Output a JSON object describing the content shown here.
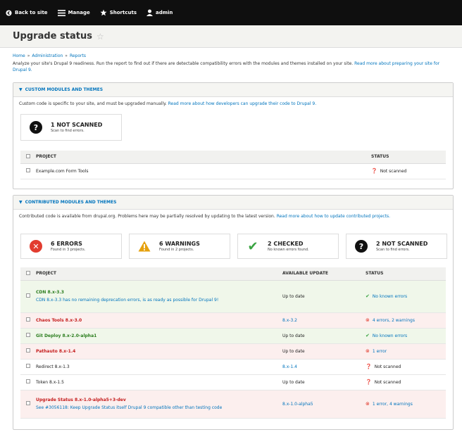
{
  "toolbar": {
    "items": [
      {
        "label": "Back to site",
        "icon": "back-circle-icon"
      },
      {
        "label": "Manage",
        "icon": "menu-icon"
      },
      {
        "label": "Shortcuts",
        "icon": "star-icon"
      },
      {
        "label": "admin",
        "icon": "user-icon"
      }
    ]
  },
  "page": {
    "title": "Upgrade status",
    "title_icon": "star-outline-icon"
  },
  "breadcrumb": [
    "Home",
    "Administration",
    "Reports"
  ],
  "intro": {
    "text": "Analyze your site's Drupal 9 readiness. Run the report to find out if there are detectable compatibility errors with the modules and themes installed on your site.",
    "link": "Read more about preparing your site for Drupal 9."
  },
  "custom": {
    "heading": "CUSTOM MODULES AND THEMES",
    "desc": "Custom code is specific to your site, and must be upgraded manually.",
    "desc_link": "Read more about how developers can upgrade their code to Drupal 9.",
    "summary": {
      "title": "1 NOT SCANNED",
      "sub": "Scan to find errors."
    },
    "columns": [
      "PROJECT",
      "STATUS"
    ],
    "rows": [
      {
        "name": "Example.com Form Tools",
        "status": "Not scanned"
      }
    ]
  },
  "contrib": {
    "heading": "CONTRIBUTED MODULES AND THEMES",
    "desc": "Contributed code is available from drupal.org. Problems here may be partially resolved by updating to the latest version.",
    "desc_link": "Read more about how to update contributed projects.",
    "summaries": [
      {
        "title": "6 ERRORS",
        "sub": "Found in 3 projects.",
        "icon": "error-x-icon",
        "color": "#e23c2f"
      },
      {
        "title": "6 WARNINGS",
        "sub": "Found in 2 projects.",
        "icon": "warning-icon",
        "color": "#e6a10d"
      },
      {
        "title": "2 CHECKED",
        "sub": "No known errors found.",
        "icon": "check-icon",
        "color": "#3aa442"
      },
      {
        "title": "2 NOT SCANNED",
        "sub": "Scan to find errors.",
        "icon": "question-icon",
        "color": "#111111"
      }
    ],
    "columns": [
      "PROJECT",
      "AVAILABLE UPDATE",
      "STATUS"
    ],
    "rows": [
      {
        "name": "CDN 8.x-3.3",
        "sub": "CDN 8.x-3.3 has no remaining deprecation errors, is as ready as possible for Drupal 9!",
        "update": "Up to date",
        "status": "No known errors",
        "kind": "ok"
      },
      {
        "name": "Chaos Tools 8.x-3.0",
        "sub": "",
        "update": "8.x-3.2",
        "status": "4 errors, 2 warnings",
        "kind": "err"
      },
      {
        "name": "Git Deploy 8.x-2.0-alpha1",
        "sub": "",
        "update": "Up to date",
        "status": "No known errors",
        "kind": "ok"
      },
      {
        "name": "Pathauto 8.x-1.4",
        "sub": "",
        "update": "Up to date",
        "status": "1 error",
        "kind": "err"
      },
      {
        "name": "Redirect 8.x-1.3",
        "sub": "",
        "update": "8.x-1.4",
        "status": "Not scanned",
        "kind": "plain"
      },
      {
        "name": "Token 8.x-1.5",
        "sub": "",
        "update": "Up to date",
        "status": "Not scanned",
        "kind": "plain"
      },
      {
        "name": "Upgrade Status 8.x-1.0-alpha5+3-dev",
        "sub": "See #3056118: Keep Upgrade Status itself Drupal 9 compatible other than testing code",
        "update": "8.x-1.0-alpha5",
        "status": "1 error, 4 warnings",
        "kind": "err"
      }
    ]
  },
  "colors": {
    "link": "#0074bd",
    "ok": "#2b7d1e",
    "error": "#c51c1c",
    "toolbar": "#0f0f0f"
  }
}
